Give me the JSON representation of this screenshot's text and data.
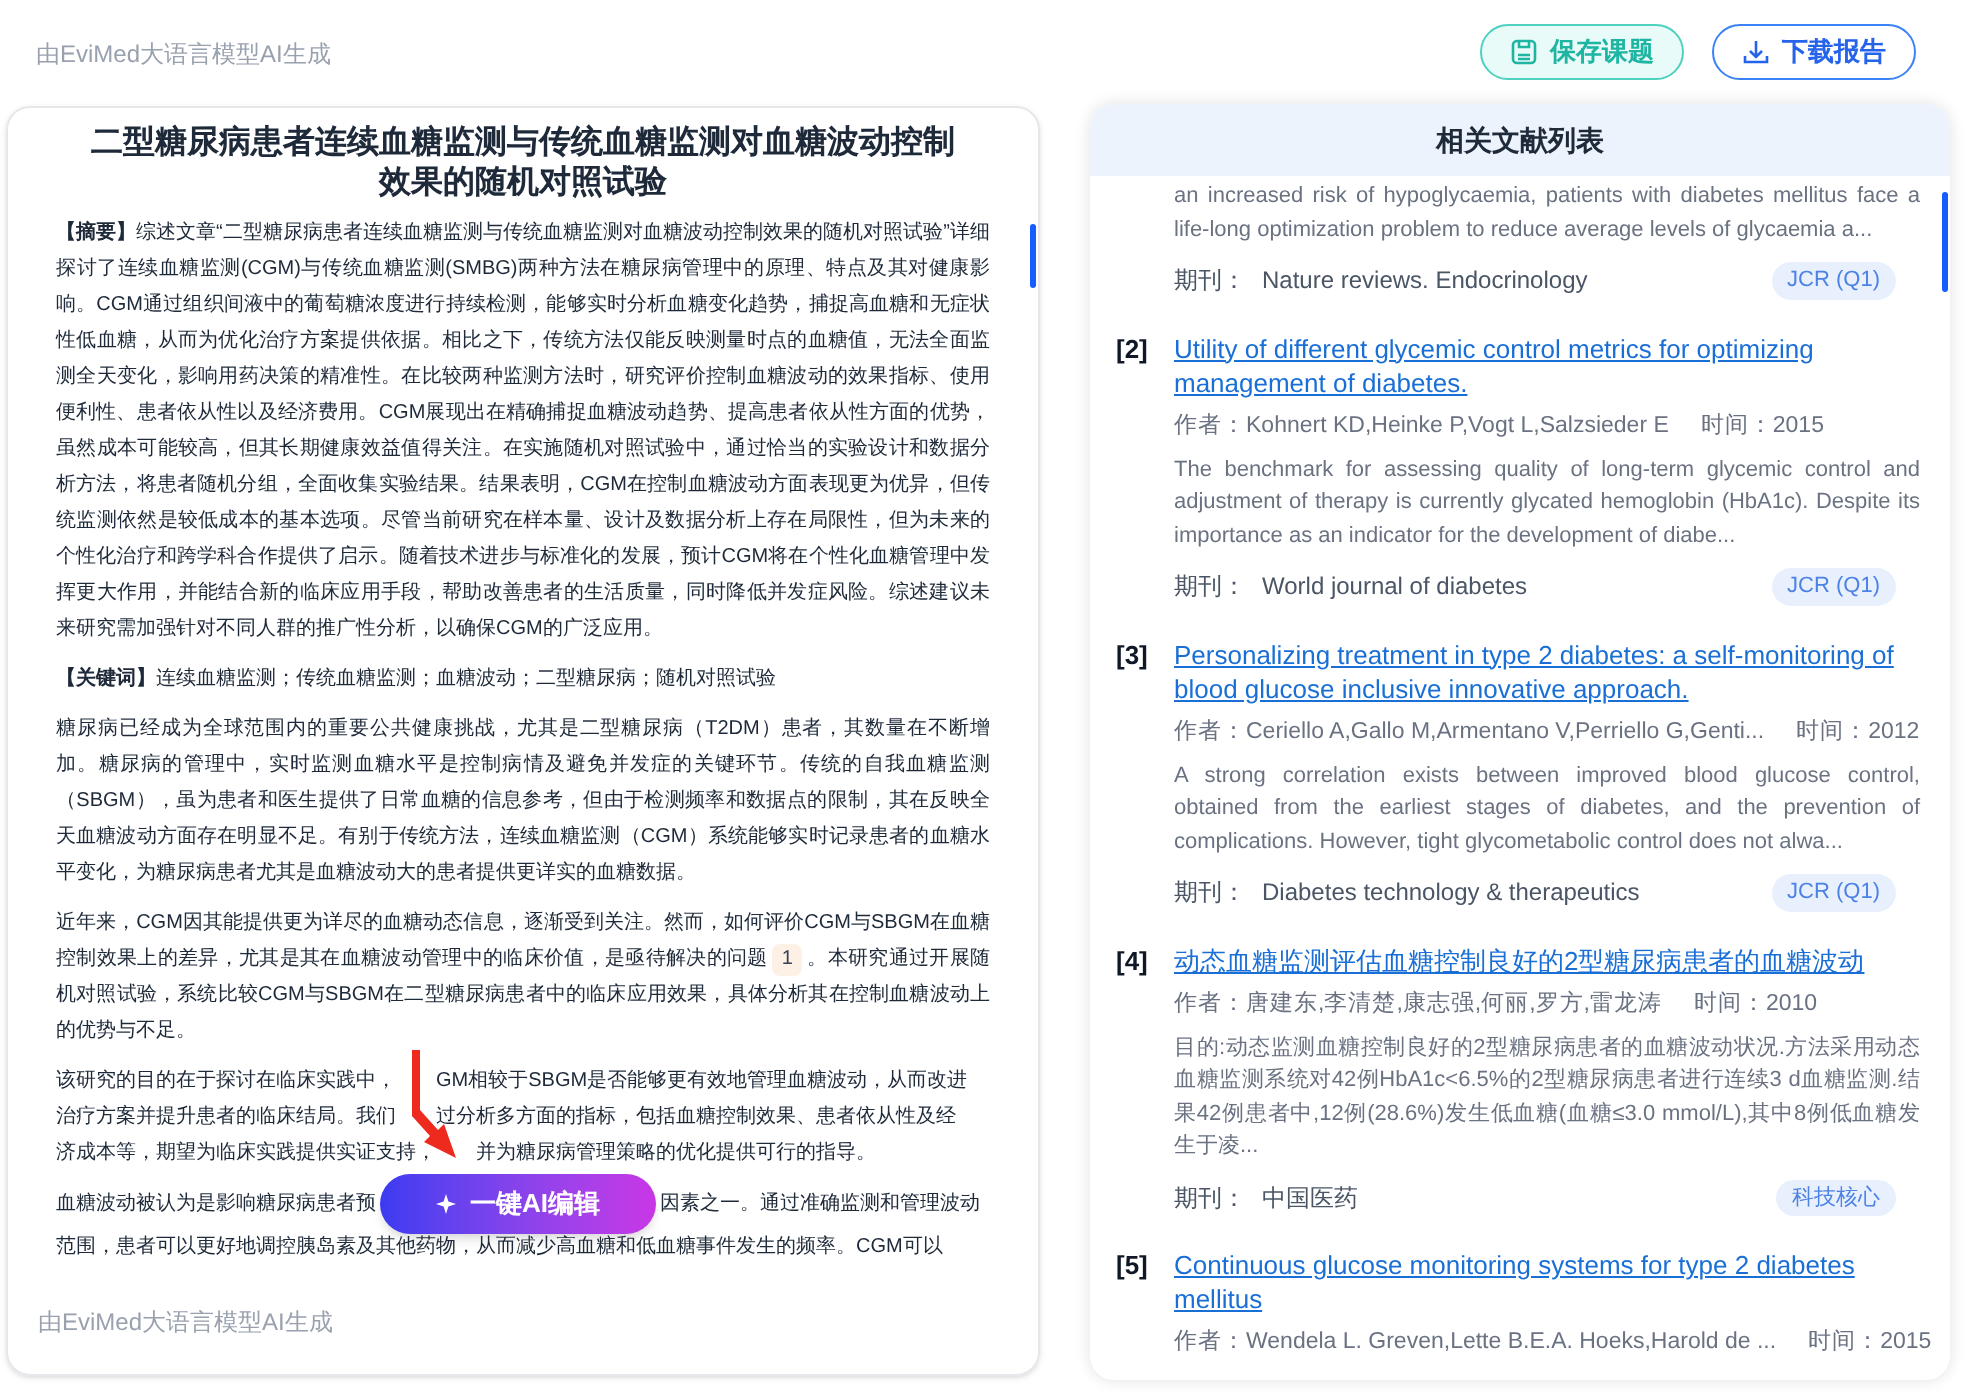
{
  "top_caption": "由EviMed大语言模型AI生成",
  "buttons": [
    {
      "label": "保存课题",
      "kind": "save"
    },
    {
      "label": "下载报告",
      "kind": "download"
    }
  ],
  "article": {
    "title": "二型糖尿病患者连续血糖监测与传统血糖监测对血糖波动控制效果的随机对照试验",
    "abstract_label": "【摘要】",
    "abstract": "综述文章“二型糖尿病患者连续血糖监测与传统血糖监测对血糖波动控制效果的随机对照试验”详细探讨了连续血糖监测(CGM)与传统血糖监测(SMBG)两种方法在糖尿病管理中的原理、特点及其对健康影响。CGM通过组织间液中的葡萄糖浓度进行持续检测，能够实时分析血糖变化趋势，捕捉高血糖和无症状性低血糖，从而为优化治疗方案提供依据。相比之下，传统方法仅能反映测量时点的血糖值，无法全面监测全天变化，影响用药决策的精准性。在比较两种监测方法时，研究评价控制血糖波动的效果指标、使用便利性、患者依从性以及经济费用。CGM展现出在精确捕捉血糖波动趋势、提高患者依从性方面的优势，虽然成本可能较高，但其长期健康效益值得关注。在实施随机对照试验中，通过恰当的实验设计和数据分析方法，将患者随机分组，全面收集实验结果。结果表明，CGM在控制血糖波动方面表现更为优异，但传统监测依然是较低成本的基本选项。尽管当前研究在样本量、设计及数据分析上存在局限性，但为未来的个性化治疗和跨学科合作提供了启示。随着技术进步与标准化的发展，预计CGM将在个性化血糖管理中发挥更大作用，并能结合新的临床应用手段，帮助改善患者的生活质量，同时降低并发症风险。综述建议未来研究需加强针对不同人群的推广性分析，以确保CGM的广泛应用。",
    "keywords_label": "【关键词】",
    "keywords": "连续血糖监测；传统血糖监测；血糖波动；二型糖尿病；随机对照试验",
    "paragraphs": [
      {
        "parts": [
          {
            "kind": "text",
            "text": "糖尿病已经成为全球范围内的重要公共健康挑战，尤其是二型糖尿病（T2DM）患者，其数量在不断增加。糖尿病的管理中，实时监测血糖水平是控制病情及避免并发症的关键环节。传统的自我血糖监测（SBGM），虽为患者和医生提供了日常血糖的信息参考，但由于检测频率和数据点的限制，其在反映全天血糖波动方面存在明显不足。有别于传统方法，连续血糖监测（CGM）系统能够实时记录患者的血糖水平变化，为糖尿病患者尤其是血糖波动大的患者提供更详实的血糖数据。"
          }
        ]
      },
      {
        "parts": [
          {
            "kind": "text",
            "text": "近年来，CGM因其能提供更为详尽的血糖动态信息，逐渐受到关注。然而，如何评价CGM与SBGM在血糖控制效果上的差异，尤其是其在血糖波动管理中的临床价值，是亟待解决的问题"
          },
          {
            "kind": "cite",
            "text": "1"
          },
          {
            "kind": "text",
            "text": "。本研究通过开展随机对照试验，系统比较CGM与SBGM在二型糖尿病患者中的临床应用效果，具体分析其在控制血糖波动上的优势与不足。"
          }
        ]
      },
      {
        "lines": [
          [
            "该研究的目的在于探讨在临床实践中，",
            "GM相较于SBGM是否能够更有效地管理血糖波动，从而改进"
          ],
          [
            "治疗方案并提升患者的临床结局。我们",
            "过分析多方面的指标，包括血糖控制效果、患者依从性及经"
          ],
          [
            "济成本等，期望为临床实践提供实证支持，",
            "并为糖尿病管理策略的优化提供可行的指导。"
          ]
        ]
      }
    ],
    "last_paragraph_before": "血糖波动被认为是影响糖尿病患者预",
    "ai_button": "一键AI编辑",
    "last_paragraph_after": [
      "因素之一。通过准确监测和管理波动",
      "范围，患者可以更好地调控胰岛素及其他药物，从而减少高血糖和低血糖事件发生的频率。CGM可以"
    ],
    "footer": "由EviMed大语言模型AI生成"
  },
  "references": {
    "title": "相关文献列表",
    "items": [
      {
        "abstract": "an increased risk of hypoglycaemia, patients with diabetes mellitus face a life-long optimization problem to reduce average levels of glycaemia a...",
        "journal_label": "期刊：",
        "journal": "Nature reviews. Endocrinology",
        "badge": "JCR (Q1)"
      },
      {
        "index": "[2]",
        "title": "Utility of different glycemic control metrics for optimizing management of diabetes.",
        "authors": "作者：Kohnert KD,Heinke P,Vogt L,Salzsieder E",
        "time": "时间：2015",
        "abstract": "The benchmark for assessing quality of long-term glycemic control and adjustment of therapy is currently glycated hemoglobin (HbA1c). Despite its importance as an indicator for the development of diabe...",
        "journal_label": "期刊：",
        "journal": "World journal of diabetes",
        "badge": "JCR (Q1)"
      },
      {
        "index": "[3]",
        "title": "Personalizing treatment in type 2 diabetes: a self-monitoring of blood glucose inclusive innovative approach.",
        "authors": "作者：Ceriello A,Gallo M,Armentano V,Perriello G,Genti...",
        "time": "时间：2012",
        "abstract": "A strong correlation exists between improved blood glucose control, obtained from the earliest stages of diabetes, and the prevention of complications. However, tight glycometabolic control does not alwa...",
        "journal_label": "期刊：",
        "journal": "Diabetes technology & therapeutics",
        "badge": "JCR (Q1)"
      },
      {
        "index": "[4]",
        "title": "动态血糖监测评估血糖控制良好的2型糖尿病患者的血糖波动",
        "authors": "作者：唐建东,李清楚,康志强,何丽,罗方,雷龙涛",
        "time": "时间：2010",
        "abstract": "目的:动态监测血糖控制良好的2型糖尿病患者的血糖波动状况.方法采用动态血糖监测系统对42例HbA1c<6.5%的2型糖尿病患者进行连续3 d血糖监测.结果42例患者中,12例(28.6%)发生低血糖(血糖≤3.0 mmol/L),其中8例低血糖发生于凌...",
        "journal_label": "期刊：",
        "journal": "中国医药",
        "badge": "科技核心"
      },
      {
        "index": "[5]",
        "title": "Continuous glucose monitoring systems for type 2 diabetes mellitus",
        "authors": "作者：Wendela L. Greven,Lette B.E.A. Hoeks,Harold de ...",
        "time": "时间：2015"
      }
    ]
  }
}
